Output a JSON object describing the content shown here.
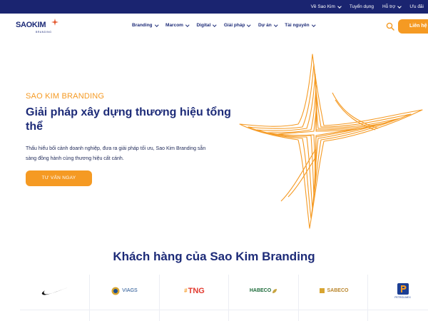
{
  "topbar": {
    "items": [
      "Về Sao Kim",
      "Tuyển dụng",
      "Hỗ trợ",
      "Ưu đãi"
    ]
  },
  "header": {
    "logo_text": "SAOKIM",
    "logo_sub": "BRANDING",
    "nav": [
      "Branding",
      "Marcom",
      "Digital",
      "Giải pháp",
      "Dự án",
      "Tài nguyên"
    ],
    "contact_label": "Liên hệ"
  },
  "hero": {
    "eyebrow": "SAO KIM BRANDING",
    "title": "Giải pháp xây dựng thương hiệu tổng thể",
    "description": "Thấu hiểu bối cảnh doanh nghiệp, đưa ra giải pháp tối ưu, Sao Kim Branding sẵn sàng đồng hành cùng thương hiệu cất cánh.",
    "cta_label": "TƯ VẤN NGAY"
  },
  "clients": {
    "title": "Khách hàng của Sao Kim Branding",
    "logos": [
      "Nike",
      "VIAGS",
      "TNG",
      "HABECO",
      "SABECO",
      "PETROLIMEX"
    ]
  },
  "colors": {
    "navy": "#1a2470",
    "brand_text": "#1d2b78",
    "accent": "#f59a23"
  }
}
